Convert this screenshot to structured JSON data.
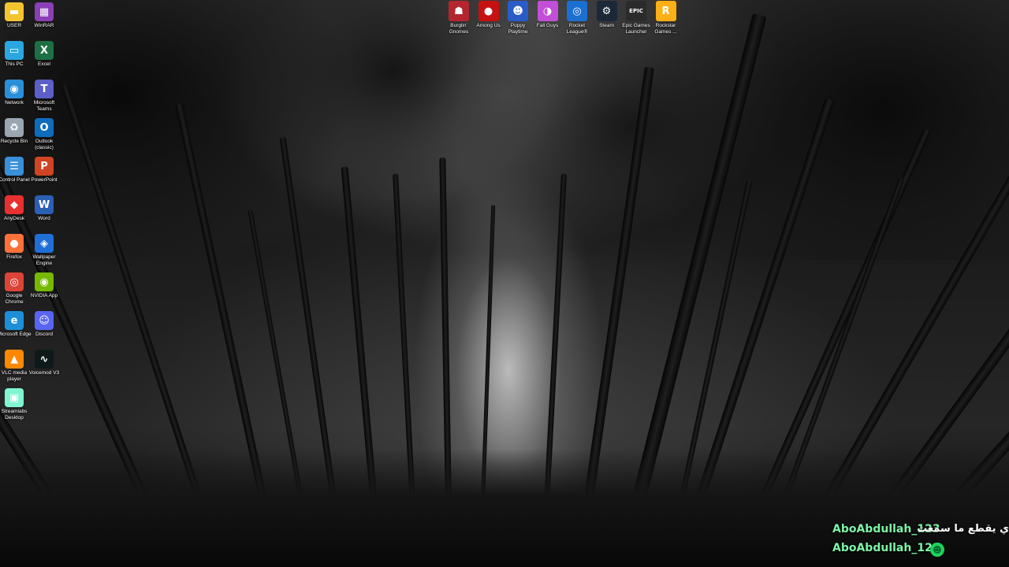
{
  "desktop": {
    "left_column": [
      {
        "label": "USER",
        "icon": "folder-icon",
        "color": "#f4c430",
        "glyph": "▬"
      },
      {
        "label": "This PC",
        "icon": "monitor-icon",
        "color": "#2aa7e0",
        "glyph": "▭"
      },
      {
        "label": "Network",
        "icon": "network-icon",
        "color": "#2b8fd8",
        "glyph": "◉"
      },
      {
        "label": "Recycle Bin",
        "icon": "recycle-bin-icon",
        "color": "#9aa6b2",
        "glyph": "♻"
      },
      {
        "label": "Control Panel",
        "icon": "control-panel-icon",
        "color": "#3a8fd9",
        "glyph": "☰"
      },
      {
        "label": "AnyDesk",
        "icon": "anydesk-icon",
        "color": "#e8312f",
        "glyph": "◆"
      },
      {
        "label": "Firefox",
        "icon": "firefox-icon",
        "color": "#ff7139",
        "glyph": "●"
      },
      {
        "label": "Google Chrome",
        "icon": "chrome-icon",
        "color": "#db4437",
        "glyph": "◎"
      },
      {
        "label": "Microsoft Edge",
        "icon": "edge-icon",
        "color": "#1d8fd8",
        "glyph": "e"
      },
      {
        "label": "VLC media player",
        "icon": "vlc-icon",
        "color": "#ff8800",
        "glyph": "▲"
      },
      {
        "label": "Streamlabs Desktop",
        "icon": "streamlabs-icon",
        "color": "#80f5d2",
        "glyph": "▣"
      }
    ],
    "right_column": [
      {
        "label": "WinRAR",
        "icon": "winrar-icon",
        "color": "#8b3fb5",
        "glyph": "▦"
      },
      {
        "label": "Excel",
        "icon": "excel-icon",
        "color": "#1d7044",
        "glyph": "X"
      },
      {
        "label": "Microsoft Teams",
        "icon": "teams-icon",
        "color": "#5b5fc7",
        "glyph": "T"
      },
      {
        "label": "Outlook (classic)",
        "icon": "outlook-icon",
        "color": "#0f6cbd",
        "glyph": "O"
      },
      {
        "label": "PowerPoint",
        "icon": "powerpoint-icon",
        "color": "#d04423",
        "glyph": "P"
      },
      {
        "label": "Word",
        "icon": "word-icon",
        "color": "#2b5fb4",
        "glyph": "W"
      },
      {
        "label": "Wallpaper Engine",
        "icon": "wallpaper-engine-icon",
        "color": "#1f6fd6",
        "glyph": "◈"
      },
      {
        "label": "NVIDIA App",
        "icon": "nvidia-icon",
        "color": "#76b900",
        "glyph": "◉"
      },
      {
        "label": "Discord",
        "icon": "discord-icon",
        "color": "#5865f2",
        "glyph": "☺"
      },
      {
        "label": "Voicemod V3",
        "icon": "voicemod-icon",
        "color": "#0e1a1a",
        "glyph": "∿"
      }
    ],
    "games": [
      {
        "label": "Burglin' Gnomes",
        "icon": "burglin-gnomes-icon",
        "color": "#b3262e",
        "glyph": "☗"
      },
      {
        "label": "Among Us",
        "icon": "among-us-icon",
        "color": "#c51111",
        "glyph": "●"
      },
      {
        "label": "Poppy Playtime",
        "icon": "poppy-playtime-icon",
        "color": "#2a5cc7",
        "glyph": "☻"
      },
      {
        "label": "Fall Guys",
        "icon": "fall-guys-icon",
        "color": "#c34fd8",
        "glyph": "◑"
      },
      {
        "label": "Rocket League®",
        "icon": "rocket-league-icon",
        "color": "#1b6fd1",
        "glyph": "◎"
      },
      {
        "label": "Steam",
        "icon": "steam-icon",
        "color": "#1b2838",
        "glyph": "⚙"
      },
      {
        "label": "Epic Games Launcher",
        "icon": "epic-games-icon",
        "color": "#2b2b2b",
        "glyph": "EPIC"
      },
      {
        "label": "Rockstar Games ...",
        "icon": "rockstar-icon",
        "color": "#fcaf17",
        "glyph": "R"
      }
    ]
  },
  "chat": [
    {
      "user": "AboAbdullah_123",
      "message": "ي يقطع ما سمعت"
    },
    {
      "user": "AboAbdullah_123",
      "message": "",
      "badge": "smiley-badge-icon"
    }
  ]
}
